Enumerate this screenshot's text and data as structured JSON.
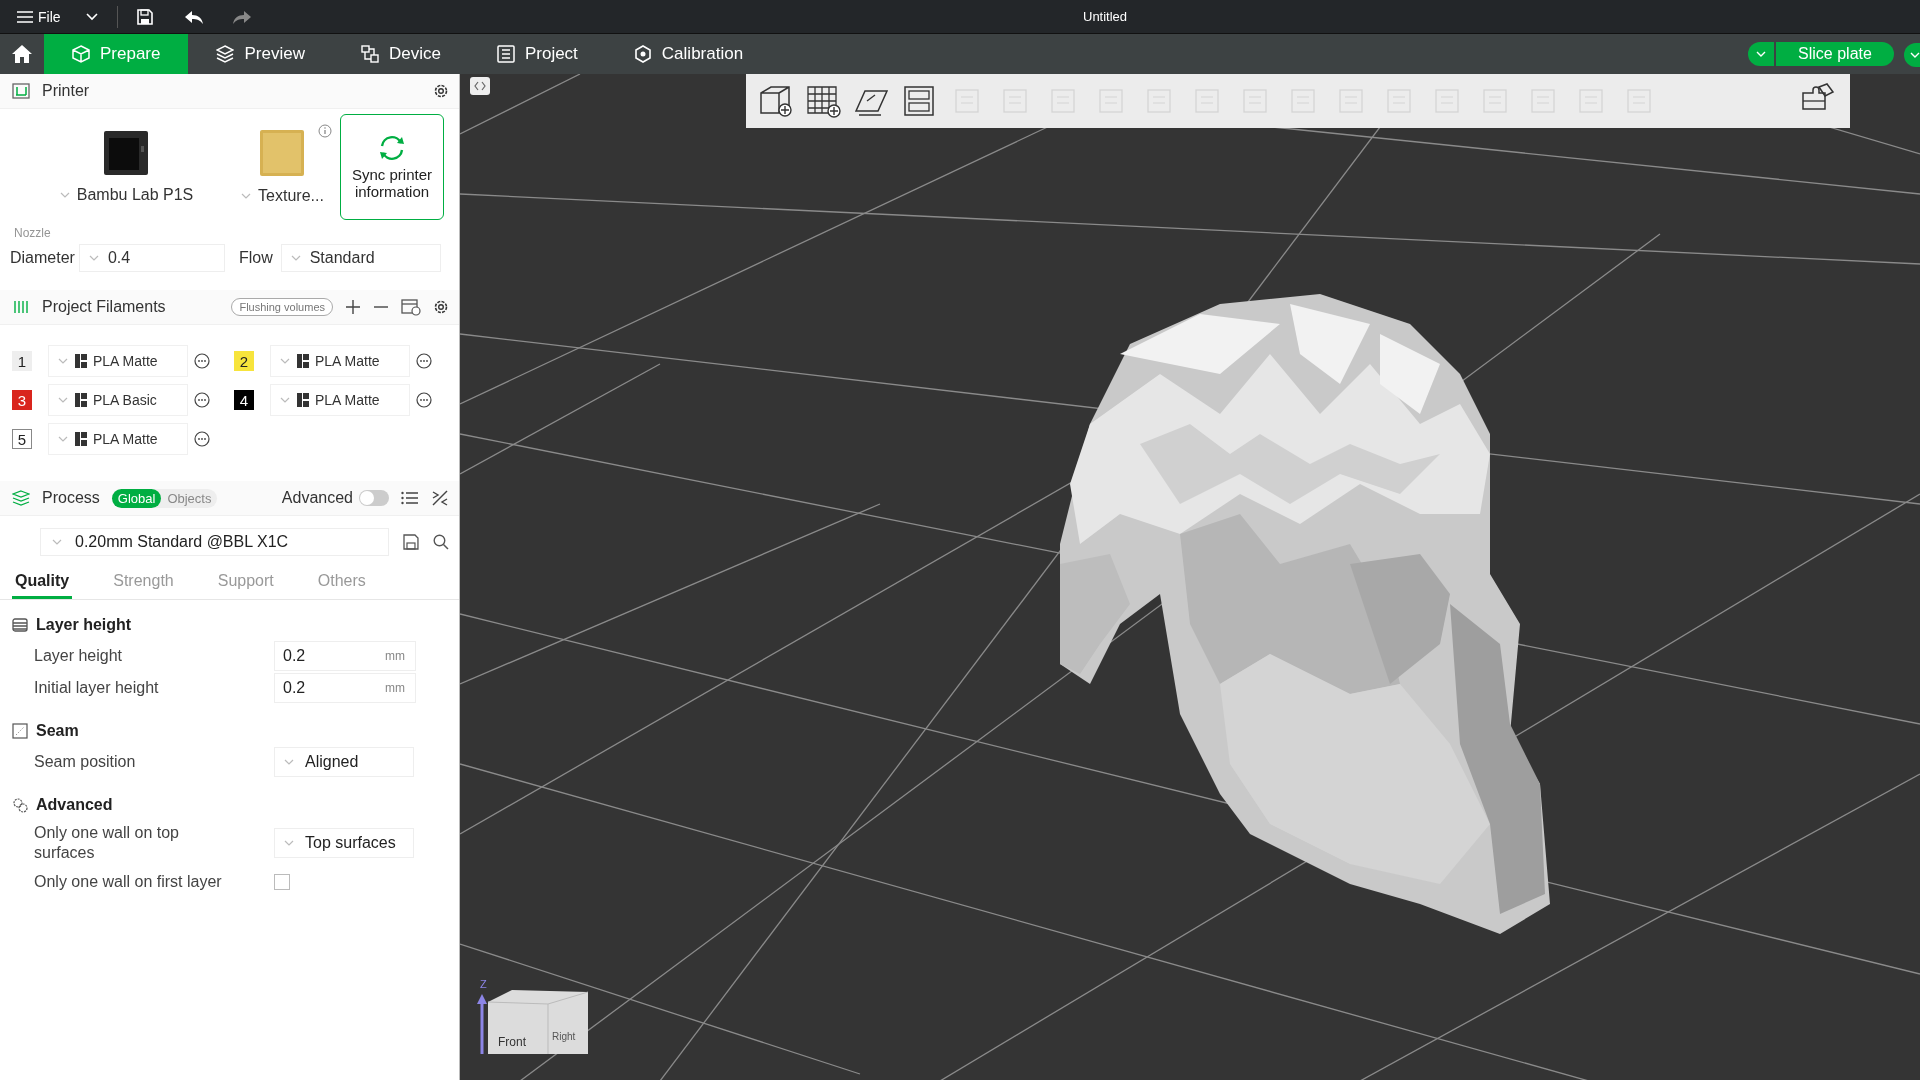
{
  "title_bar": {
    "menu": "File",
    "title": "Untitled"
  },
  "nav_tabs": [
    {
      "label": "Prepare",
      "kind": "prepare",
      "selected": true
    },
    {
      "label": "Preview",
      "kind": "preview",
      "selected": false
    },
    {
      "label": "Device",
      "kind": "device",
      "selected": false
    },
    {
      "label": "Project",
      "kind": "project",
      "selected": false
    },
    {
      "label": "Calibration",
      "kind": "calibration",
      "selected": false
    }
  ],
  "slice_button": "Slice plate",
  "printer": {
    "title": "Printer",
    "printer_name": "Bambu Lab P1S",
    "plate": "Texture...",
    "sync_button": "Sync printer information",
    "nozzle_label": "Nozzle",
    "diameter_label": "Diameter",
    "diameter": "0.4",
    "flow_label": "Flow",
    "flow": "Standard"
  },
  "filaments": {
    "title": "Project Filaments",
    "flushing_button": "Flushing volumes",
    "items": [
      {
        "number": "1",
        "name": "PLA Matte",
        "color": "#eeeeee"
      },
      {
        "number": "2",
        "name": "PLA Matte",
        "color": "#f7e43c"
      },
      {
        "number": "3",
        "name": "PLA Basic",
        "color": "#d9251d"
      },
      {
        "number": "4",
        "name": "PLA Matte",
        "color": "#000000"
      },
      {
        "number": "5",
        "name": "PLA Matte",
        "color": "#ffffff"
      }
    ]
  },
  "process": {
    "title": "Process",
    "scopes": [
      {
        "label": "Global",
        "selected": true
      },
      {
        "label": "Objects",
        "selected": false
      }
    ],
    "advanced_label": "Advanced",
    "advanced_on": false,
    "preset": "0.20mm Standard @BBL X1C",
    "tabs": [
      {
        "label": "Quality",
        "selected": true
      },
      {
        "label": "Strength",
        "selected": false
      },
      {
        "label": "Support",
        "selected": false
      },
      {
        "label": "Others",
        "selected": false
      }
    ],
    "groups": [
      {
        "title": "Layer height",
        "kind": "layers",
        "settings": [
          {
            "kind": "number",
            "label": "Layer height",
            "value": "0.2",
            "unit": "mm"
          },
          {
            "kind": "number",
            "label": "Initial layer height",
            "value": "0.2",
            "unit": "mm"
          }
        ]
      },
      {
        "title": "Seam",
        "kind": "seam",
        "settings": [
          {
            "kind": "select",
            "label": "Seam position",
            "value": "Aligned"
          }
        ]
      },
      {
        "title": "Advanced",
        "kind": "advanced",
        "settings": [
          {
            "kind": "select",
            "label": "Only one wall on top surfaces",
            "value": "Top surfaces"
          },
          {
            "kind": "checkbox",
            "label": "Only one wall on first layer",
            "checked": false
          }
        ]
      }
    ]
  },
  "toolbar_tools": [
    {
      "kind": "add-cube",
      "disabled": false
    },
    {
      "kind": "add-grid",
      "disabled": false
    },
    {
      "kind": "plate",
      "disabled": false
    },
    {
      "kind": "layout",
      "disabled": false
    },
    {
      "kind": "tool",
      "disabled": true
    },
    {
      "kind": "tool",
      "disabled": true
    },
    {
      "kind": "tool",
      "disabled": true
    },
    {
      "kind": "tool",
      "disabled": true
    },
    {
      "kind": "tool",
      "disabled": true
    },
    {
      "kind": "tool",
      "disabled": true
    },
    {
      "kind": "tool",
      "disabled": true
    },
    {
      "kind": "tool",
      "disabled": true
    },
    {
      "kind": "tool",
      "disabled": true
    },
    {
      "kind": "tool",
      "disabled": true
    },
    {
      "kind": "tool",
      "disabled": true
    },
    {
      "kind": "tool",
      "disabled": true
    },
    {
      "kind": "tool",
      "disabled": true
    },
    {
      "kind": "tool",
      "disabled": true
    },
    {
      "kind": "tool",
      "disabled": true
    },
    {
      "kind": "assemble",
      "disabled": false
    }
  ],
  "nav_cube": {
    "axis": "Z",
    "front": "Front",
    "right": "Right"
  }
}
